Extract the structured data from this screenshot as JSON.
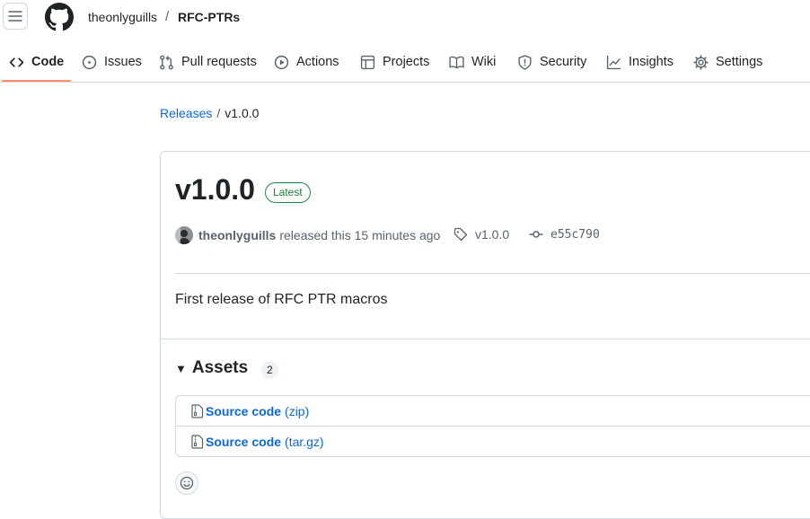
{
  "header": {
    "owner": "theonlyguills",
    "separator": "/",
    "repo": "RFC-PTRs"
  },
  "tabs": [
    {
      "label": "Code",
      "icon": "code-icon",
      "active": true
    },
    {
      "label": "Issues",
      "icon": "issue-opened-icon"
    },
    {
      "label": "Pull requests",
      "icon": "git-pull-request-icon"
    },
    {
      "label": "Actions",
      "icon": "play-icon"
    },
    {
      "label": "Projects",
      "icon": "table-icon"
    },
    {
      "label": "Wiki",
      "icon": "book-icon"
    },
    {
      "label": "Security",
      "icon": "shield-icon"
    },
    {
      "label": "Insights",
      "icon": "graph-icon"
    },
    {
      "label": "Settings",
      "icon": "gear-icon"
    }
  ],
  "breadcrumb": {
    "root": "Releases",
    "separator": "/",
    "current": "v1.0.0"
  },
  "release": {
    "title": "v1.0.0",
    "badge": "Latest",
    "author": "theonlyguills",
    "released_text": "released this 15 minutes ago",
    "tag": "v1.0.0",
    "commit": "e55c790",
    "body": "First release of RFC PTR macros"
  },
  "assets": {
    "heading": "Assets",
    "count": "2",
    "items": [
      {
        "name": "Source code",
        "ext": "(zip)",
        "icon": "file-zip-icon"
      },
      {
        "name": "Source code",
        "ext": "(tar.gz)",
        "icon": "file-zip-icon"
      }
    ]
  },
  "colors": {
    "link": "#0969da",
    "latest_green": "#1a7f37",
    "tab_underline": "#fd8c73",
    "border": "#d1d9e0",
    "muted": "#59636e"
  }
}
